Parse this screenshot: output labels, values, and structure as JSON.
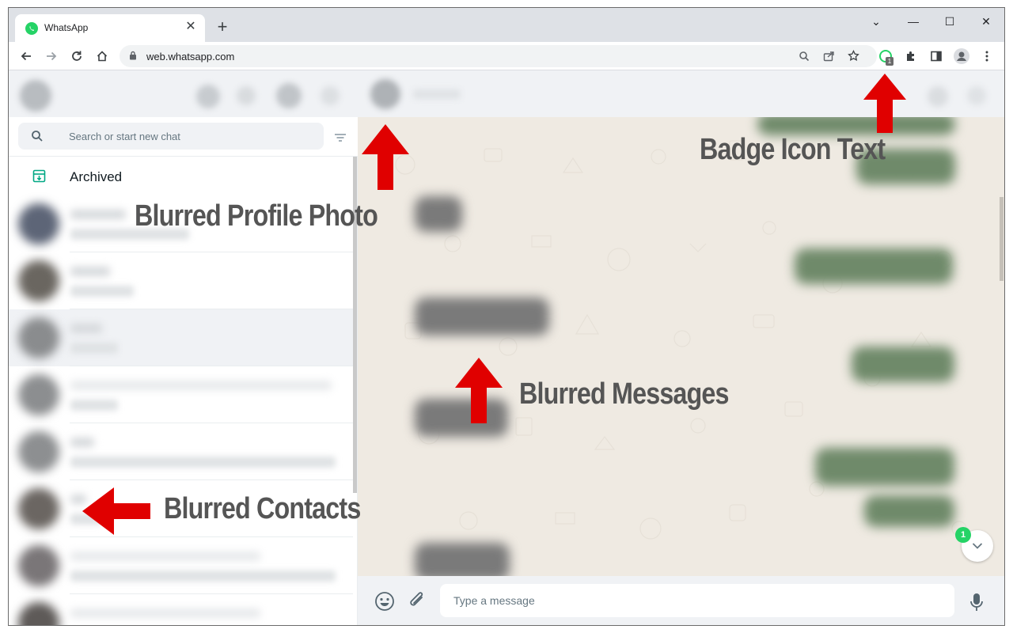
{
  "browser": {
    "tab_title": "WhatsApp",
    "tab_close": "✕",
    "new_tab": "+",
    "url": "web.whatsapp.com",
    "extension_badge": "1",
    "window_controls": [
      "⌄",
      "—",
      "☐",
      "✕"
    ]
  },
  "left_panel": {
    "search_placeholder": "Search or start new chat",
    "archived_label": "Archived"
  },
  "chat": {
    "unread_count": "1",
    "input_placeholder": "Type a message"
  },
  "annotations": {
    "badge_icon_text": "Badge Icon Text",
    "blurred_profile_photo": "Blurred Profile Photo",
    "blurred_messages": "Blurred Messages",
    "blurred_contacts": "Blurred Contacts"
  },
  "colors": {
    "whatsapp_green": "#25d366",
    "arrow_red": "#e00000",
    "chat_background": "#efeae2"
  }
}
